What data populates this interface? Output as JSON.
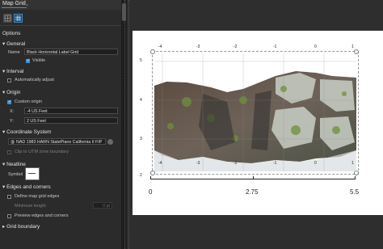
{
  "header": {
    "tab_label": "Map Grid"
  },
  "options_title": "Options",
  "general": {
    "title": "General",
    "name_label": "Name",
    "name_value": "Black Horizontal Label Grid",
    "visible_label": "Visible"
  },
  "interval": {
    "title": "Interval",
    "auto_adjust_label": "Automatically adjust"
  },
  "origin": {
    "title": "Origin",
    "custom_label": "Custom origin",
    "x_label": "X:",
    "x_value": "-4 US Feet",
    "y_label": "Y:",
    "y_value": "2 US Feet"
  },
  "coord": {
    "title": "Coordinate System",
    "value": "NAD 1983 HARN StatePlane California II FIP",
    "clip_label": "Clip to UTM zone boundary"
  },
  "neatline": {
    "title": "Neatline",
    "symbol_label": "Symbol"
  },
  "edges": {
    "title": "Edges and corners",
    "define_label": "Define map grid edges",
    "min_length_label": "Minimum length",
    "min_length_value": "0 pt",
    "preview_label": "Preview edges and corners"
  },
  "boundary": {
    "title": "Grid boundary"
  },
  "map": {
    "top_ticks": [
      "-4",
      "-3",
      "-2",
      "-1",
      "0",
      "1"
    ],
    "bottom_ticks": [
      "-4",
      "-3",
      "-2",
      "-1",
      "0",
      "1"
    ],
    "left_ticks": [
      "5",
      "4",
      "3",
      "2"
    ],
    "scale_labels": [
      "0",
      "2.75",
      "5.5"
    ]
  },
  "colors": {
    "accent": "#3a8fd6",
    "panel_bg": "#2b2b2b",
    "canvas_bg": "#2e2e2e"
  }
}
